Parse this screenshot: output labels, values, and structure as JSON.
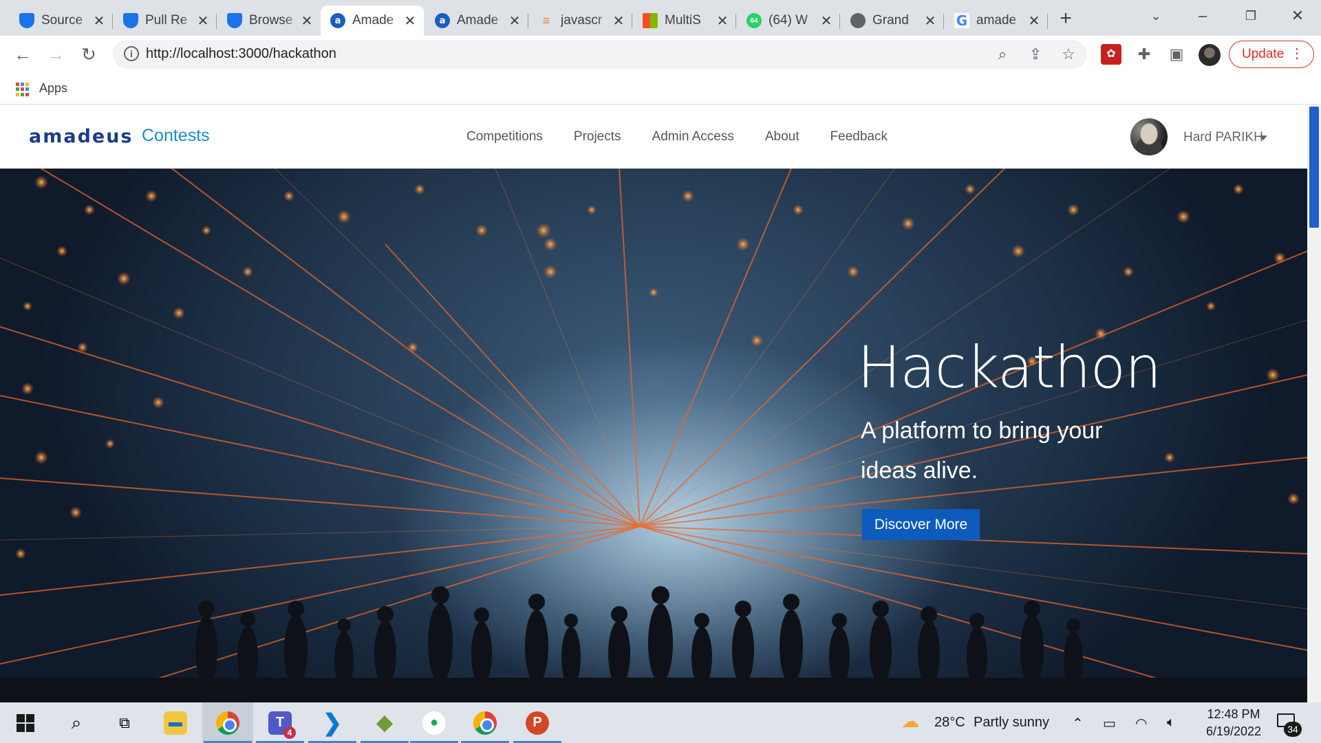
{
  "browser": {
    "tabs": [
      {
        "title": "Source",
        "favicon": "azure-devops-icon",
        "active": false
      },
      {
        "title": "Pull Re",
        "favicon": "azure-devops-icon",
        "active": false
      },
      {
        "title": "Browse",
        "favicon": "azure-devops-icon",
        "active": false
      },
      {
        "title": "Amade",
        "favicon": "amadeus-icon",
        "active": true
      },
      {
        "title": "Amade",
        "favicon": "amadeus-icon",
        "active": false
      },
      {
        "title": "javascr",
        "favicon": "stackoverflow-icon",
        "active": false
      },
      {
        "title": "MultiS",
        "favicon": "multi-icon",
        "active": false
      },
      {
        "title": "(64) W",
        "favicon": "whatsapp-icon",
        "badge": "64",
        "active": false
      },
      {
        "title": "Grand",
        "favicon": "globe-icon",
        "active": false
      },
      {
        "title": "amade",
        "favicon": "google-icon",
        "active": false
      }
    ],
    "address": "http://localhost:3000/hackathon",
    "update_label": "Update",
    "bookmarks": {
      "apps_label": "Apps"
    }
  },
  "site": {
    "brand": "amadeus",
    "brand_sub": "Contests",
    "nav": [
      "Competitions",
      "Projects",
      "Admin Access",
      "About",
      "Feedback"
    ],
    "user_name": "Hard PARIKH"
  },
  "hero": {
    "title": "Hackathon",
    "subtitle": "A platform to bring your ideas alive.",
    "cta": "Discover More"
  },
  "taskbar": {
    "weather_temp": "28°C",
    "weather_text": "Partly sunny",
    "time": "12:48 PM",
    "date": "6/19/2022",
    "notification_count": "34",
    "teams_badge": "4"
  },
  "colors": {
    "brand_blue": "#1b3c8c",
    "contests_blue": "#1a8bc9",
    "cta_blue": "#0c5bbd",
    "update_red": "#d93025"
  }
}
